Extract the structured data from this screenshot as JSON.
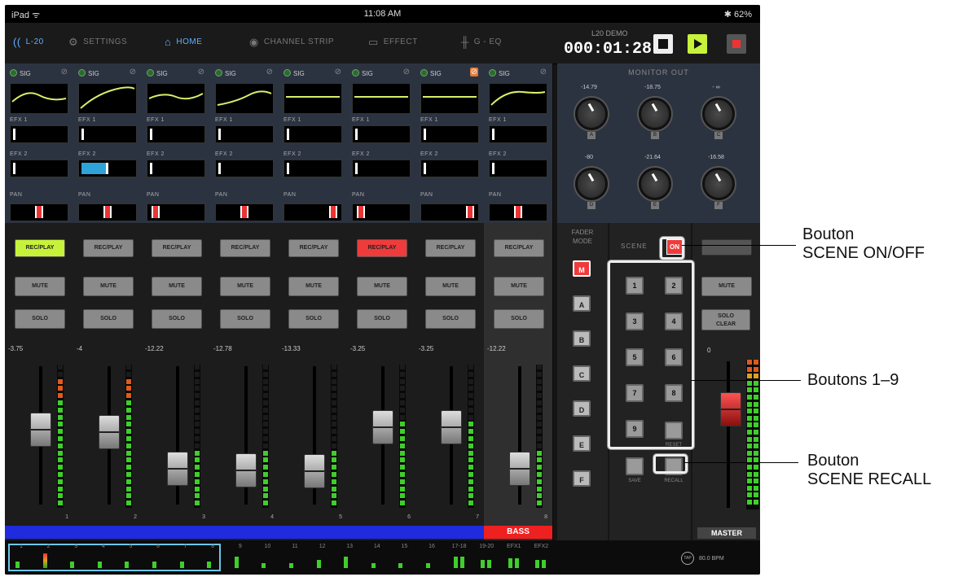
{
  "status": {
    "carrier": "iPad ᯤ",
    "time": "11:08 AM",
    "battery": "✱ 62%"
  },
  "nav": {
    "device": "L-20",
    "items": [
      "SETTINGS",
      "HOME",
      "CHANNEL STRIP",
      "EFFECT",
      "G - EQ"
    ],
    "active": "HOME"
  },
  "transport": {
    "project": "L20 DEMO",
    "time": "000:01:28"
  },
  "channels": [
    {
      "num": "1",
      "name": "",
      "level": "-3.75",
      "rec": "REC/PLAY",
      "rec_state": "green",
      "fx2": false,
      "pan": 0.5,
      "fader": 0.62,
      "phase_on": false
    },
    {
      "num": "2",
      "name": "",
      "level": "-4",
      "rec": "REC/PLAY",
      "rec_state": "off",
      "fx2": true,
      "pan": 0.5,
      "fader": 0.6,
      "phase_on": false
    },
    {
      "num": "3",
      "name": "",
      "level": "-12.22",
      "rec": "REC/PLAY",
      "rec_state": "off",
      "fx2": false,
      "pan": 0.05,
      "fader": 0.3,
      "phase_on": false
    },
    {
      "num": "4",
      "name": "",
      "level": "-12.78",
      "rec": "REC/PLAY",
      "rec_state": "off",
      "fx2": false,
      "pan": 0.5,
      "fader": 0.29,
      "phase_on": false
    },
    {
      "num": "5",
      "name": "",
      "level": "-13.33",
      "rec": "REC/PLAY",
      "rec_state": "off",
      "fx2": false,
      "pan": 0.95,
      "fader": 0.28,
      "phase_on": false
    },
    {
      "num": "6",
      "name": "",
      "level": "-3.25",
      "rec": "REC/PLAY",
      "rec_state": "red",
      "fx2": false,
      "pan": 0.05,
      "fader": 0.64,
      "phase_on": false
    },
    {
      "num": "7",
      "name": "",
      "level": "-3.25",
      "rec": "REC/PLAY",
      "rec_state": "off",
      "fx2": false,
      "pan": 0.95,
      "fader": 0.64,
      "phase_on": true
    },
    {
      "num": "8",
      "name": "BASS",
      "level": "-12.22",
      "rec": "REC/PLAY",
      "rec_state": "off",
      "fx2": false,
      "pan": 0.5,
      "fader": 0.3,
      "phase_on": false
    }
  ],
  "labels": {
    "sig": "SIG",
    "efx1": "EFX 1",
    "efx2": "EFX 2",
    "pan": "PAN",
    "mute": "MUTE",
    "solo": "SOLO"
  },
  "monitor": {
    "title": "MONITOR OUT",
    "knobs": [
      {
        "letter": "A",
        "value": "-14.79"
      },
      {
        "letter": "B",
        "value": "-18.75"
      },
      {
        "letter": "C",
        "value": "- ∞"
      },
      {
        "letter": "D",
        "value": "-80"
      },
      {
        "letter": "E",
        "value": "-21.64"
      },
      {
        "letter": "F",
        "value": "-16.58"
      }
    ]
  },
  "fader_mode": {
    "title_1": "FADER",
    "title_2": "MODE",
    "buttons": [
      "M",
      "A",
      "B",
      "C",
      "D",
      "E",
      "F"
    ],
    "active": "M"
  },
  "scene": {
    "title": "SCENE",
    "on_label": "ON",
    "numbers": [
      "1",
      "2",
      "3",
      "4",
      "5",
      "6",
      "7",
      "8",
      "9"
    ],
    "reset": "RESET",
    "save": "SAVE",
    "recall": "RECALL"
  },
  "master": {
    "mute": "MUTE",
    "solo_clear_1": "SOLO",
    "solo_clear_2": "CLEAR",
    "level": "0",
    "name": "MASTER"
  },
  "bottom": {
    "meters": [
      "1",
      "2",
      "3",
      "4",
      "5",
      "6",
      "7",
      "8",
      "9",
      "10",
      "11",
      "12",
      "13",
      "14",
      "15",
      "16",
      "17-18",
      "19-20",
      "EFX1",
      "EFX2"
    ],
    "tap": "TAP",
    "bpm": "80.0 BPM"
  },
  "annotations": {
    "scene_onoff_1": "Bouton",
    "scene_onoff_2": "SCENE ON/OFF",
    "buttons_1_9": "Boutons 1–9",
    "scene_recall_1": "Bouton",
    "scene_recall_2": "SCENE RECALL"
  },
  "colors": {
    "rec_green": "#c7f23a",
    "rec_red": "#ef3b3b",
    "channel_blue": "#1f2bdc",
    "channel_red": "#ef2020",
    "active_nav": "#5fb0ff"
  }
}
